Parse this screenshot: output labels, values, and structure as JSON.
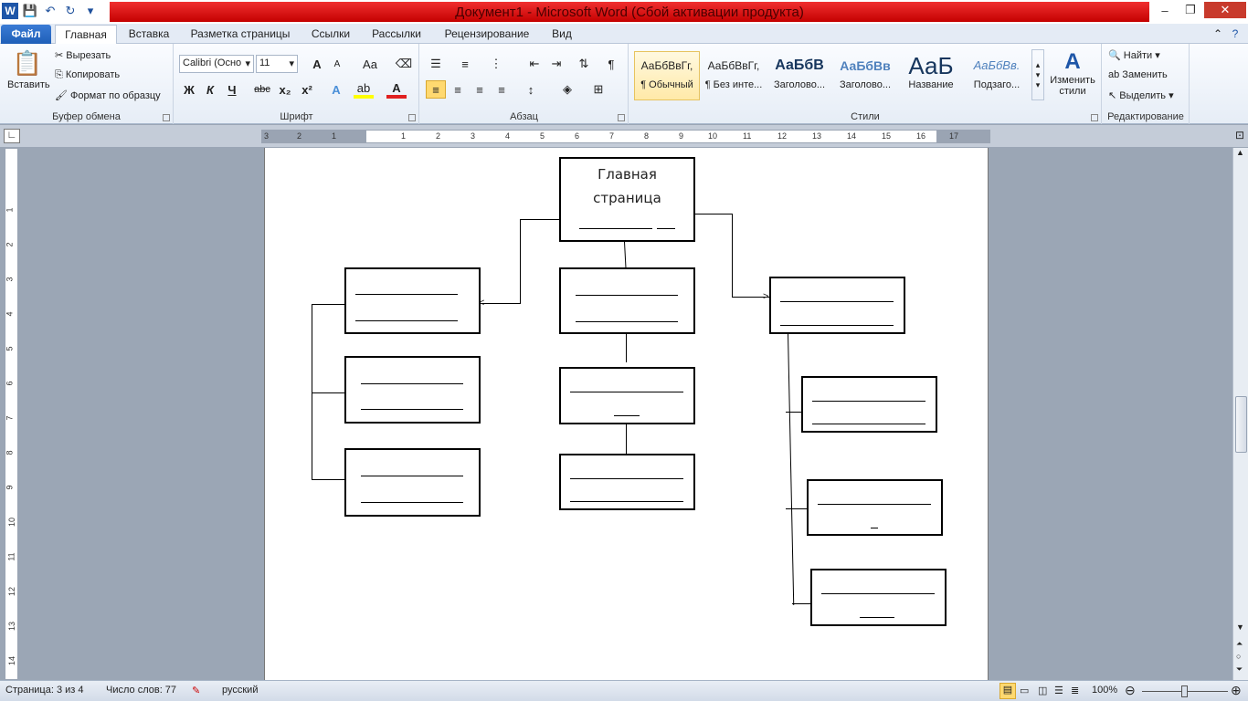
{
  "window": {
    "title": "Документ1  -  Microsoft Word (Сбой активации продукта)",
    "app_icon": "W",
    "controls": {
      "minimize": "–",
      "restore": "❐",
      "close": "✕"
    }
  },
  "qat": {
    "save": "💾",
    "undo": "↶",
    "redo": "↻",
    "customize": "▾"
  },
  "tabs": {
    "file": "Файл",
    "home": "Главная",
    "insert": "Вставка",
    "layout": "Разметка страницы",
    "references": "Ссылки",
    "mailings": "Рассылки",
    "review": "Рецензирование",
    "view": "Вид"
  },
  "clipboard": {
    "paste": "Вставить",
    "cut": "Вырезать",
    "copy": "Копировать",
    "format_painter": "Формат по образцу",
    "label": "Буфер обмена"
  },
  "font": {
    "name": "Calibri (Осно",
    "size": "11",
    "label": "Шрифт",
    "bold": "Ж",
    "italic": "К",
    "underline": "Ч",
    "strike": "abc",
    "sub": "x₂",
    "sup": "x²",
    "grow": "A",
    "shrink": "A",
    "case": "Aa"
  },
  "paragraph": {
    "label": "Абзац",
    "pilcrow": "¶"
  },
  "styles": {
    "label": "Стили",
    "items": [
      {
        "preview": "АаБбВвГг,",
        "name": "¶ Обычный"
      },
      {
        "preview": "АаБбВвГг,",
        "name": "¶ Без инте..."
      },
      {
        "preview": "АаБбВ",
        "name": "Заголово..."
      },
      {
        "preview": "АаБбВв",
        "name": "Заголово..."
      },
      {
        "preview": "АаБ",
        "name": "Название"
      },
      {
        "preview": "АаБбВв.",
        "name": "Подзаго..."
      }
    ],
    "change": "Изменить стили"
  },
  "editing": {
    "label": "Редактирование",
    "find": "Найти",
    "replace": "Заменить",
    "select": "Выделить"
  },
  "ruler": {
    "h": [
      "3",
      "2",
      "1",
      "1",
      "2",
      "3",
      "4",
      "5",
      "6",
      "7",
      "8",
      "9",
      "10",
      "11",
      "12",
      "13",
      "14",
      "15",
      "16",
      "17"
    ],
    "v": [
      "1",
      "2",
      "3",
      "4",
      "5",
      "6",
      "7",
      "8",
      "9",
      "10",
      "11",
      "12",
      "13",
      "14"
    ]
  },
  "document": {
    "top_box_line1": "Главная",
    "top_box_line2": "страница"
  },
  "status": {
    "page": "Страница: 3 из 4",
    "words": "Число слов: 77",
    "lang": "русский",
    "zoom": "100%"
  }
}
